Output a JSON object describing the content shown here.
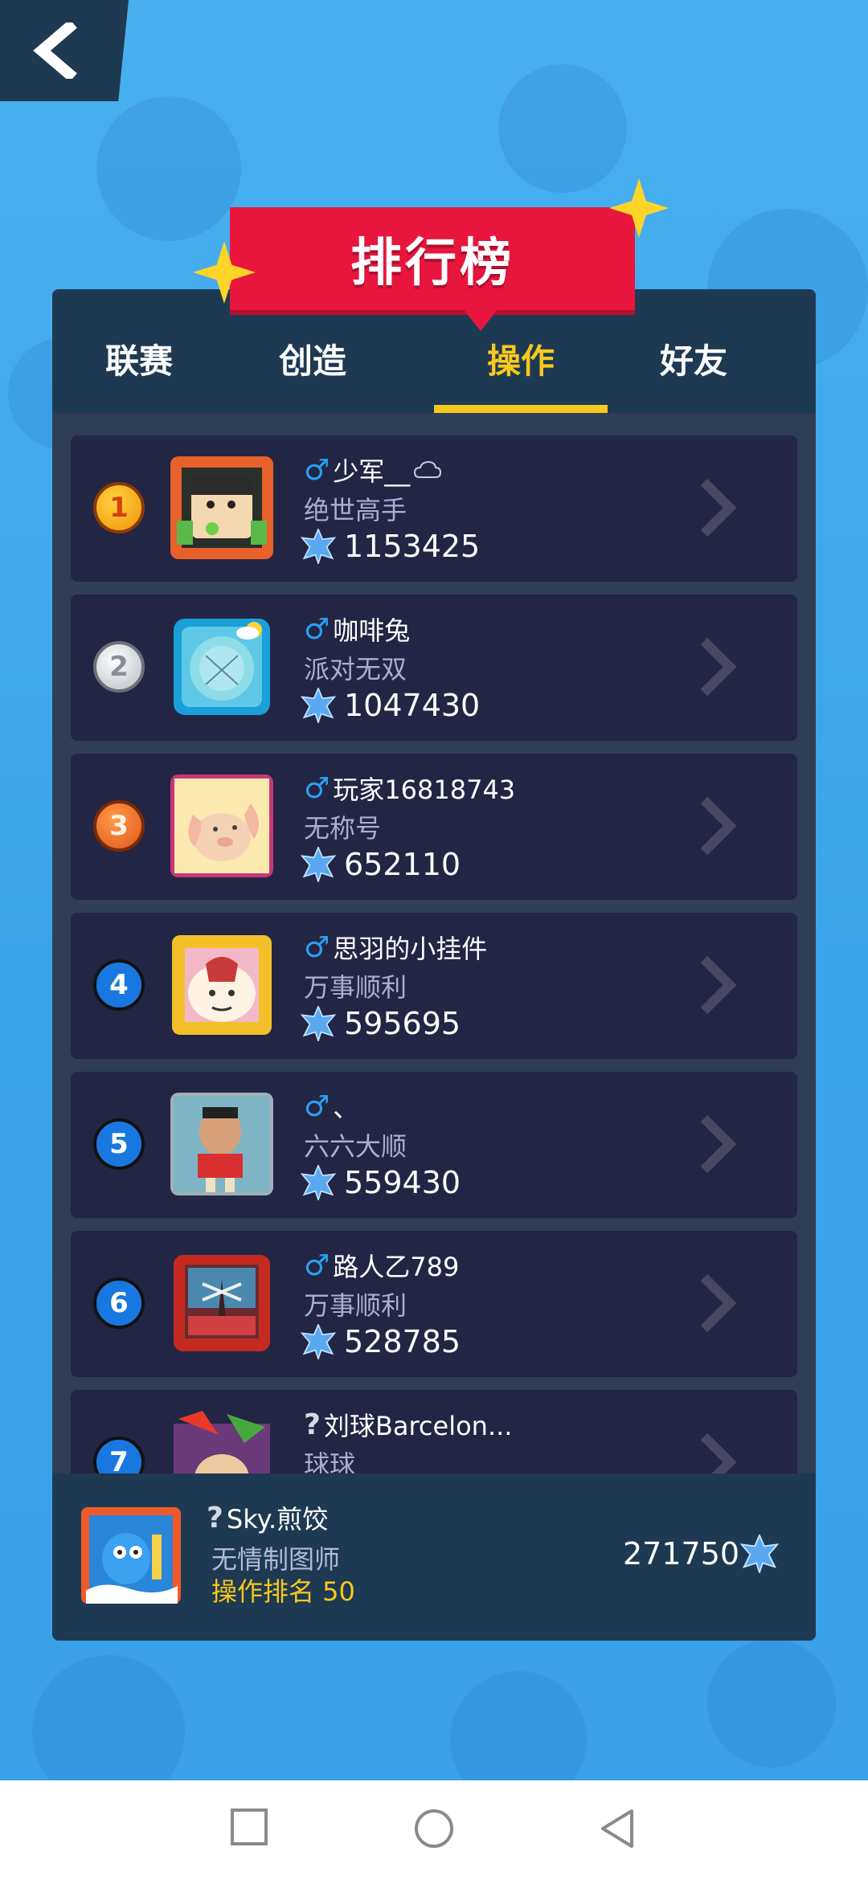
{
  "header": {
    "title": "排行榜"
  },
  "tabs": [
    {
      "label": "联赛",
      "active": false
    },
    {
      "label": "创造",
      "active": false
    },
    {
      "label": "操作",
      "active": true
    },
    {
      "label": "好友",
      "active": false
    }
  ],
  "leaderboard": [
    {
      "rank": "1",
      "gender": "♂",
      "name": "少军__",
      "title": "绝世高手",
      "score": "1153425"
    },
    {
      "rank": "2",
      "gender": "♂",
      "name": "咖啡兔",
      "title": "派对无双",
      "score": "1047430"
    },
    {
      "rank": "3",
      "gender": "♂",
      "name": "玩家16818743",
      "title": "无称号",
      "score": "652110"
    },
    {
      "rank": "4",
      "gender": "♂",
      "name": "思羽的小挂件",
      "title": "万事顺利",
      "score": "595695"
    },
    {
      "rank": "5",
      "gender": "♂",
      "name": "、",
      "title": "六六大顺",
      "score": "559430"
    },
    {
      "rank": "6",
      "gender": "♂",
      "name": "路人乙789",
      "title": "万事顺利",
      "score": "528785"
    },
    {
      "rank": "7",
      "gender": "?",
      "name": "刘球Barcelon...",
      "title": "球球",
      "score": ""
    }
  ],
  "me": {
    "gender": "?",
    "name": "Sky.煎饺",
    "title": "无情制图师",
    "rank_text": "操作排名 50",
    "score": "271750"
  },
  "colors": {
    "accent": "#f8c81e",
    "ribbon": "#e8163d",
    "panel": "#1b3448",
    "row": "#232544",
    "gender_male": "#29a0f0"
  }
}
